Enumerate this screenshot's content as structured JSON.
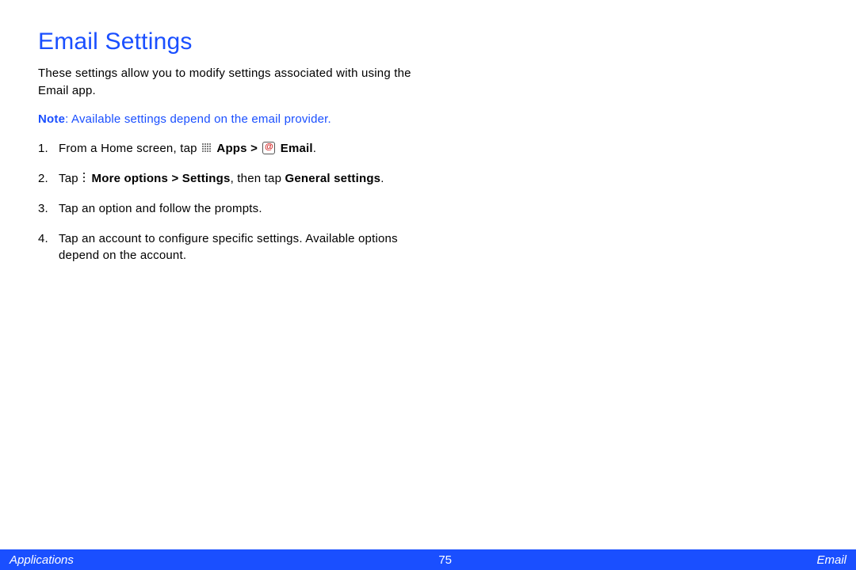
{
  "title": "Email Settings",
  "intro": "These settings allow you to modify settings associated with using the Email app.",
  "note_label": "Note",
  "note_text": ": Available settings depend on the email provider.",
  "steps": {
    "s1_pre": "From a Home screen, tap ",
    "s1_apps": "Apps > ",
    "s1_email": " Email",
    "s1_period": ".",
    "s2_pre": "Tap ",
    "s2_more": "More options > Settings",
    "s2_mid": ", then tap ",
    "s2_general": "General settings",
    "s2_period": ".",
    "s3": "Tap an option and follow the prompts.",
    "s4": "Tap an account to configure specific settings. Available options depend on the account."
  },
  "footer": {
    "left": "Applications",
    "page": "75",
    "right": "Email"
  }
}
